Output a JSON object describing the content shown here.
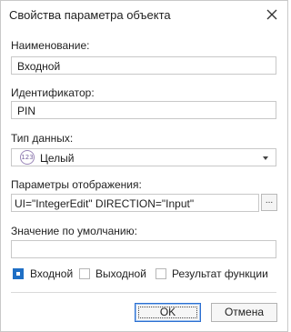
{
  "dialog": {
    "title": "Свойства параметра объекта",
    "close_icon": "close-icon"
  },
  "fields": {
    "name": {
      "label": "Наименование:",
      "value": "Входной"
    },
    "identifier": {
      "label": "Идентификатор:",
      "value": "PIN"
    },
    "datatype": {
      "label": "Тип данных:",
      "value": "Целый",
      "icon": "integer-type-icon",
      "icon_text": "123"
    },
    "display_params": {
      "label": "Параметры отображения:",
      "value": "UI=\"IntegerEdit\" DIRECTION=\"Input\"",
      "button_label": "..."
    },
    "default_value": {
      "label": "Значение по умолчанию:",
      "value": ""
    }
  },
  "checkboxes": [
    {
      "label": "Входной",
      "checked": true
    },
    {
      "label": "Выходной",
      "checked": false
    },
    {
      "label": "Результат функции",
      "checked": false
    }
  ],
  "buttons": {
    "ok_label": "OK",
    "cancel_label": "Отмена"
  },
  "colors": {
    "accent": "#1f6fc5",
    "border": "#c8c8c8"
  }
}
